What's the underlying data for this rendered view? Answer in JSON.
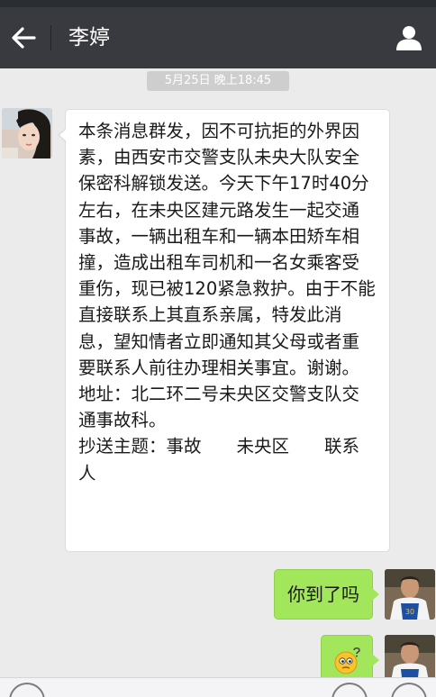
{
  "header": {
    "title": "李婷",
    "back_icon": "arrow-left-icon",
    "profile_icon": "person-icon"
  },
  "chat": {
    "timestamp": "5月25日 晚上18:45",
    "incoming": {
      "text": "本条消息群发，因不可抗拒的外界因素，由西安市交警支队未央大队安全保密科解锁发送。今天下午17时40分左右，在未央区建元路发生一起交通事故，一辆出租车和一辆本田矫车相撞，造成出租车司机和一名女乘客受重伤，现已被120紧急救护。由于不能直接联系上其直系亲属，特发此消息，望知情者立即通知其父母或者重要联系人前往办理相关事宜。谢谢。\n地址：北二环二号未央区交警支队交通事故科。\n抄送主题：事故　　未央区　　联系人"
    },
    "outgoing": [
      {
        "text": "你到了吗"
      },
      {
        "emoji": "confused-face-emoji"
      }
    ]
  },
  "input_bar": {
    "voice_icon": "voice-icon",
    "emoji_icon": "emoji-icon",
    "plus_icon": "plus-icon"
  },
  "colors": {
    "title_bar": "#393a3f",
    "background": "#ebebeb",
    "outgoing_bubble": "#a2e65b",
    "incoming_bubble": "#ffffff"
  }
}
